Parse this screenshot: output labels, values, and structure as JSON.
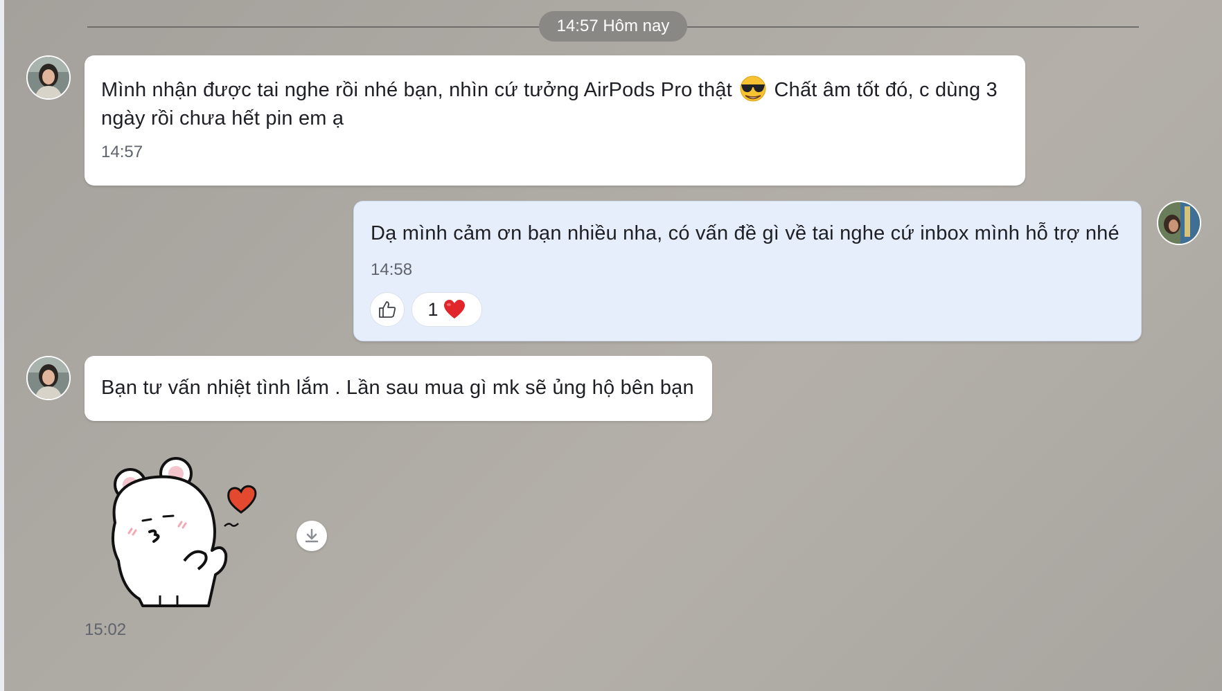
{
  "date_separator": {
    "label": "14:57 Hôm nay"
  },
  "messages": [
    {
      "direction": "received",
      "text_part1": "Mình nhận được tai nghe rồi nhé bạn, nhìn cứ tưởng AirPods Pro thật",
      "emoji": "smiling-face-with-sunglasses",
      "text_part2": "Chất âm tốt đó, c dùng 3 ngày rồi chưa hết pin em ạ",
      "time": "14:57"
    },
    {
      "direction": "sent",
      "text": "Dạ mình cảm ơn bạn nhiều nha, có vấn đề gì về tai nghe cứ inbox mình hỗ trợ nhé",
      "time": "14:58",
      "reaction": {
        "count": "1",
        "emoji": "red-heart"
      }
    },
    {
      "direction": "received",
      "text": "Bạn tư vấn nhiệt tình lắm . Lần sau mua gì mk sẽ ủng hộ bên bạn"
    },
    {
      "direction": "received",
      "type": "sticker",
      "sticker": "white-bear-blowing-kiss-with-heart",
      "time": "15:02"
    }
  ],
  "icons": {
    "like": "thumbs-up-icon",
    "download": "download-icon"
  },
  "colors": {
    "background": "#aaa7a1",
    "received_bubble": "#ffffff",
    "sent_bubble": "#e6edfb",
    "date_pill": "#8a8884",
    "heart": "#e0252b"
  }
}
